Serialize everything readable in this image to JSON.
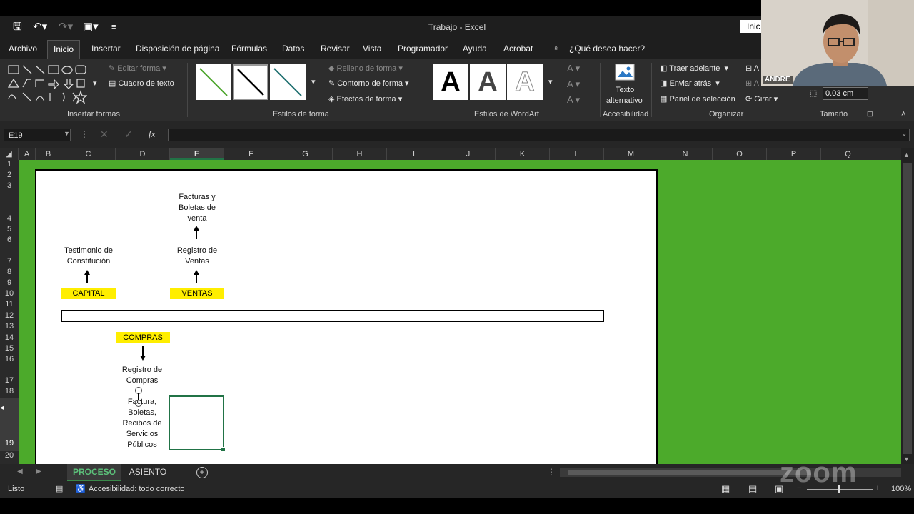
{
  "window": {
    "title": "Trabajo  -  Excel",
    "signin": "Inic"
  },
  "tabs": [
    "Archivo",
    "Inicio",
    "Insertar",
    "Disposición de página",
    "Fórmulas",
    "Datos",
    "Revisar",
    "Vista",
    "Programador",
    "Ayuda",
    "Acrobat",
    "¿Qué desea hacer?"
  ],
  "ribbon": {
    "insert_shapes": {
      "edit_shape": "Editar forma",
      "textbox": "Cuadro de texto",
      "label": "Insertar formas"
    },
    "shape_styles": {
      "fill": "Relleno de forma",
      "outline": "Contorno de forma",
      "effects": "Efectos de forma",
      "label": "Estilos de forma"
    },
    "wordart": {
      "sample": "A",
      "label": "Estilos de WordArt"
    },
    "accessibility": {
      "alt_text_1": "Texto",
      "alt_text_2": "alternativo",
      "label": "Accesibilidad"
    },
    "arrange": {
      "bring_forward": "Traer adelante",
      "send_backward": "Enviar atrás",
      "selection_pane": "Panel de selección",
      "rotate": "Girar",
      "label": "Organizar"
    },
    "size": {
      "value": "0.03 cm",
      "label": "Tamaño"
    }
  },
  "formula_bar": {
    "name_box": "E19",
    "fx": "fx",
    "value": ""
  },
  "columns": [
    "A",
    "B",
    "C",
    "D",
    "E",
    "F",
    "G",
    "H",
    "I",
    "J",
    "K",
    "L",
    "M",
    "N",
    "O",
    "P",
    "Q"
  ],
  "rows": [
    "1",
    "2",
    "3",
    "4",
    "5",
    "6",
    "7",
    "8",
    "9",
    "10",
    "11",
    "12",
    "13",
    "14",
    "15",
    "16",
    "17",
    "18",
    "19",
    "20"
  ],
  "diagram": {
    "facturas_ventas": [
      "Facturas y",
      "Boletas de",
      "venta"
    ],
    "registro_ventas": [
      "Registro de",
      "Ventas"
    ],
    "testimonio": [
      "Testimonio de",
      "Constitución"
    ],
    "capital": "CAPITAL",
    "ventas": "VENTAS",
    "compras": "COMPRAS",
    "registro_compras": [
      "Registro de",
      "Compras"
    ],
    "factura_compras": [
      "Factura,",
      "Boletas,",
      "Recibos de",
      "Servicios",
      "Públicos"
    ]
  },
  "sheets": [
    "PROCESO",
    "ASIENTO"
  ],
  "status": {
    "ready": "Listo",
    "accessibility": "Accesibilidad: todo correcto",
    "zoom": "100%"
  },
  "webcam": {
    "name": "ANDRE",
    "watermark": "zoom"
  }
}
